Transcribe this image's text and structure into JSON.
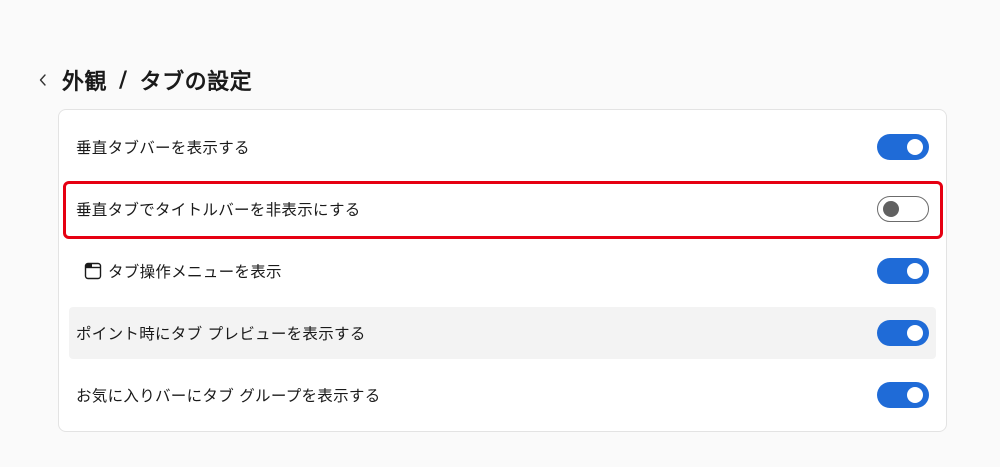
{
  "header": {
    "back_icon": "chevron-left-icon",
    "title_part1": "外観",
    "separator": "/",
    "title_part2": "タブの設定"
  },
  "settings": [
    {
      "label": "垂直タブバーを表示する",
      "enabled": true
    },
    {
      "label": "垂直タブでタイトルバーを非表示にする",
      "enabled": false
    },
    {
      "label": "タブ操作メニューを表示",
      "enabled": true,
      "icon": "tab-window-icon"
    },
    {
      "label": "ポイント時にタブ プレビューを表示する",
      "enabled": true
    },
    {
      "label": "お気に入りバーにタブ グループを表示する",
      "enabled": true
    }
  ],
  "colors": {
    "accent": "#1f6bd7",
    "highlight_border": "#e60012",
    "toggle_off_knob": "#616161"
  }
}
